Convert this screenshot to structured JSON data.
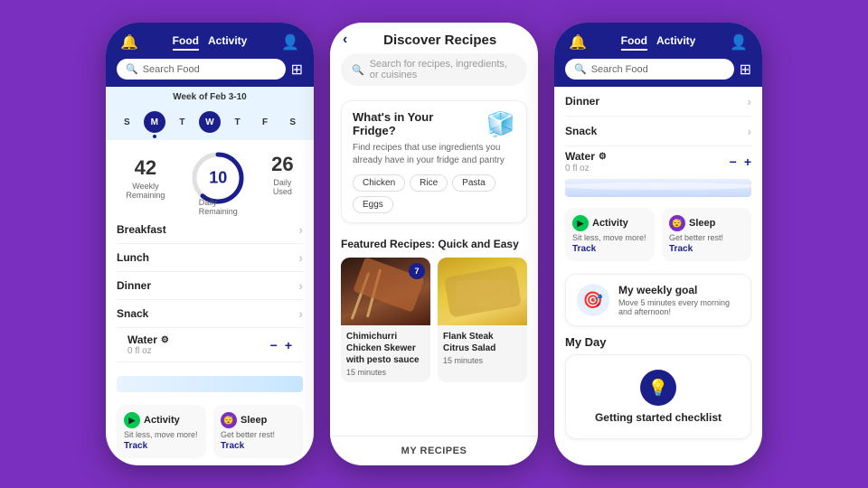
{
  "bg_color": "#7b2fbe",
  "phone1": {
    "header": {
      "food_tab": "Food",
      "activity_tab": "Activity",
      "search_placeholder": "Search Food"
    },
    "week": {
      "label": "Week of Feb 3-10",
      "days": [
        "S",
        "M",
        "T",
        "W",
        "T",
        "F",
        "S"
      ],
      "active_day_index": 1,
      "today_index": 1
    },
    "stats": {
      "weekly_remaining": "42",
      "weekly_label": "Weekly\nRemaining",
      "daily_remaining": "10",
      "daily_label": "Daily\nRemaining",
      "daily_used": "26",
      "daily_used_label": "Daily\nUsed"
    },
    "meals": [
      {
        "name": "Breakfast"
      },
      {
        "name": "Lunch"
      },
      {
        "name": "Dinner"
      },
      {
        "name": "Snack"
      }
    ],
    "water": {
      "label": "Water",
      "amount": "0 fl oz"
    },
    "activity": {
      "title": "Activity",
      "desc": "Sit less, move more!",
      "track": "Track"
    },
    "sleep": {
      "title": "Sleep",
      "desc": "Get better rest!",
      "track": "Track"
    }
  },
  "phone2": {
    "title": "Discover Recipes",
    "search_placeholder": "Search for recipes, ingredients, or cuisines",
    "fridge_card": {
      "title": "What's in Your Fridge?",
      "desc": "Find recipes that use ingredients you already have in your fridge and pantry",
      "tags": [
        "Chicken",
        "Rice",
        "Pasta",
        "Eggs"
      ]
    },
    "featured": {
      "title": "Featured Recipes: Quick and Easy",
      "recipes": [
        {
          "name": "Chimichurri Chicken Skewer with pesto sauce",
          "time": "15 minutes",
          "badge": "7"
        },
        {
          "name": "Flank Steak Citrus Salad",
          "time": "15 minutes",
          "badge": ""
        }
      ]
    },
    "my_recipes": "MY RECIPES"
  },
  "phone3": {
    "header": {
      "food_tab": "Food",
      "activity_tab": "Activity",
      "search_placeholder": "Search Food"
    },
    "meals": [
      {
        "name": "Dinner"
      },
      {
        "name": "Snack"
      }
    ],
    "water": {
      "label": "Water",
      "amount": "0 fl oz"
    },
    "activity": {
      "title": "Activity",
      "desc": "Sit less, move more!",
      "track": "Track"
    },
    "sleep": {
      "title": "Sleep",
      "desc": "Get better rest!",
      "track": "Track"
    },
    "weekly_goal": {
      "title": "My weekly goal",
      "desc": "Move 5 minutes every morning and afternoon!"
    },
    "my_day": {
      "title": "My Day",
      "checklist_title": "Getting started checklist"
    }
  }
}
